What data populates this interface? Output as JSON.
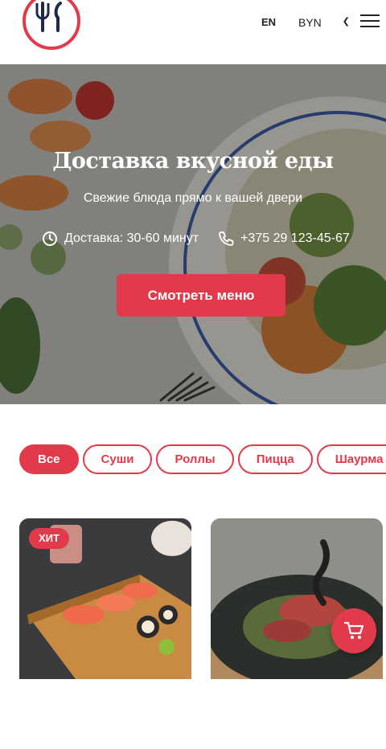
{
  "header": {
    "language": "EN",
    "currency": "BYN",
    "icons": [
      "logo-cutlery-icon",
      "chevron-down-icon",
      "menu-icon"
    ]
  },
  "hero": {
    "title": "Доставка вкусной еды",
    "subtitle": "Свежие блюда прямо к вашей двери",
    "delivery": "Доставка: 30-60 минут",
    "phone": "+375 29 123-45-67",
    "cta": "Смотреть меню"
  },
  "categories": {
    "all": "Все",
    "sushi": "Суши",
    "rolls": "Роллы",
    "pizza": "Пицца",
    "shawarma": "Шаурма"
  },
  "products": {
    "card1_badge": "ХИТ"
  },
  "colors": {
    "accent": "#e33a4b",
    "text": "#222222"
  }
}
